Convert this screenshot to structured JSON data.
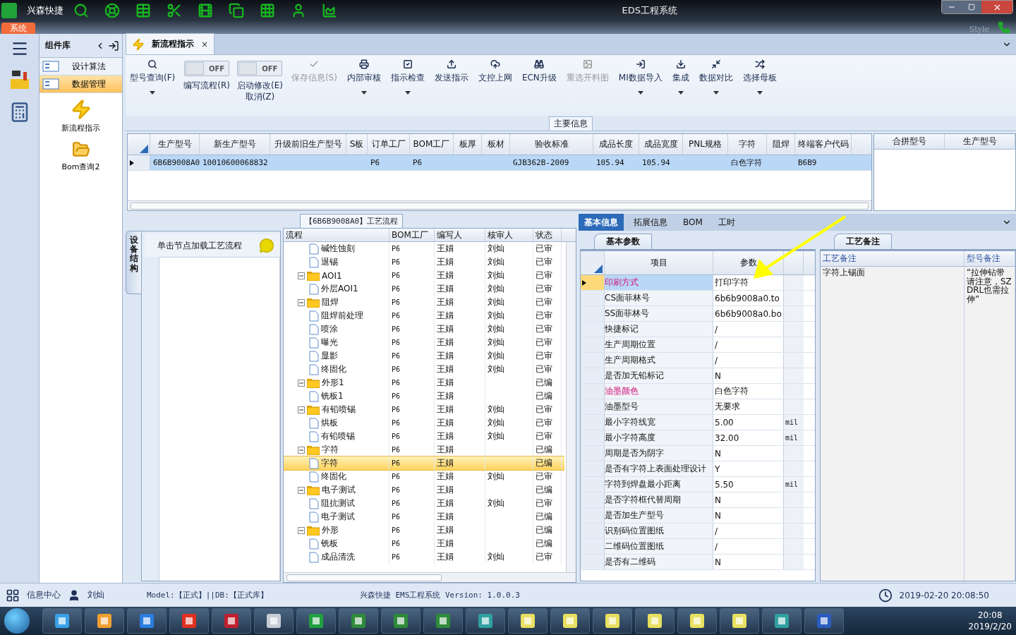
{
  "title_bar": {
    "app_name": "兴森快捷",
    "title": "EDS工程系统",
    "system_tab": "系统",
    "style_label": "Style"
  },
  "nav_panel": {
    "title": "组件库",
    "items": [
      {
        "label": "设计算法",
        "selected": false
      },
      {
        "label": "数据管理",
        "selected": true
      }
    ],
    "tiles": [
      {
        "label": "新流程指示",
        "kind": "flash"
      },
      {
        "label": "Bom查询2",
        "kind": "folder"
      }
    ]
  },
  "doc_tab": {
    "label": "新流程指示",
    "close": "×"
  },
  "ribbon": [
    {
      "kind": "button",
      "label": "型号查询(F)",
      "dropdown": true,
      "disabled": false
    },
    {
      "kind": "toggle",
      "label": "编写流程(R)",
      "state_text": "OFF",
      "on": false
    },
    {
      "kind": "toggle",
      "label": "启动修改(E)",
      "label2": "取消(Z)",
      "state_text": "OFF",
      "on": false
    },
    {
      "kind": "button",
      "label": "保存信息(S)",
      "dropdown": false,
      "disabled": true
    },
    {
      "kind": "button",
      "label": "内部审核",
      "dropdown": true,
      "disabled": false
    },
    {
      "kind": "button",
      "label": "指示检查",
      "dropdown": true,
      "disabled": false
    },
    {
      "kind": "button",
      "label": "发送指示",
      "dropdown": false,
      "disabled": false
    },
    {
      "kind": "button",
      "label": "文控上网",
      "dropdown": false,
      "disabled": false
    },
    {
      "kind": "button",
      "label": "ECN升级",
      "dropdown": false,
      "disabled": false
    },
    {
      "kind": "button",
      "label": "重选开料图",
      "dropdown": false,
      "disabled": true
    },
    {
      "kind": "button",
      "label": "MI数据导入",
      "dropdown": true,
      "disabled": false
    },
    {
      "kind": "button",
      "label": "集成",
      "dropdown": true,
      "disabled": false
    },
    {
      "kind": "button",
      "label": "数据对比",
      "dropdown": true,
      "disabled": false
    },
    {
      "kind": "button",
      "label": "选择母板",
      "dropdown": true,
      "disabled": false
    }
  ],
  "main_info": {
    "title": "主要信息",
    "columns": [
      "生产型号",
      "新生产型号",
      "升级前旧生产型号",
      "S板",
      "订单工厂",
      "BOM工厂",
      "板厚",
      "板材",
      "验收标准",
      "成品长度",
      "成品宽度",
      "PNL规格",
      "字符",
      "阻焊",
      "终端客户代码"
    ],
    "rows": [
      {
        "selected": true,
        "cells": [
          "6B6B9008A0",
          "10010600068832",
          null,
          null,
          "P6",
          "P6",
          null,
          null,
          "GJB362B-2009",
          "105.94",
          "105.94",
          null,
          "白色字符",
          null,
          "B6B9"
        ]
      }
    ],
    "side_columns": [
      "合拼型号",
      "生产型号"
    ]
  },
  "device_panel": {
    "vertical_tab": "设备结构",
    "hint": "单击节点加载工艺流程"
  },
  "process": {
    "title": "【6B6B9008A0】工艺流程",
    "columns": [
      "流程",
      "BOM工厂",
      "编写人",
      "核审人",
      "状态"
    ],
    "tree": [
      {
        "children": [
          {
            "label": "碱性蚀刻",
            "bom": "P6",
            "writer": "王娟",
            "reviewer": "刘灿",
            "status": "已审",
            "selected": false
          },
          {
            "label": "退锡",
            "bom": "P6",
            "writer": "王娟",
            "reviewer": "刘灿",
            "status": "已审",
            "selected": false
          }
        ]
      },
      {
        "label": "AOI1",
        "bom": "P6",
        "writer": "王娟",
        "reviewer": "刘灿",
        "status": "已审",
        "selected": false,
        "expanded": true,
        "children": [
          {
            "label": "外层AOI1",
            "bom": "P6",
            "writer": "王娟",
            "reviewer": "刘灿",
            "status": "已审",
            "selected": false
          }
        ]
      },
      {
        "label": "阻焊",
        "bom": "P6",
        "writer": "王娟",
        "reviewer": "刘灿",
        "status": "已审",
        "selected": false,
        "expanded": true,
        "children": [
          {
            "label": "阻焊前处理",
            "bom": "P6",
            "writer": "王娟",
            "reviewer": "刘灿",
            "status": "已审",
            "selected": false
          },
          {
            "label": "喷涂",
            "bom": "P6",
            "writer": "王娟",
            "reviewer": "刘灿",
            "status": "已审",
            "selected": false
          },
          {
            "label": "曝光",
            "bom": "P6",
            "writer": "王娟",
            "reviewer": "刘灿",
            "status": "已审",
            "selected": false
          },
          {
            "label": "显影",
            "bom": "P6",
            "writer": "王娟",
            "reviewer": "刘灿",
            "status": "已审",
            "selected": false
          },
          {
            "label": "终固化",
            "bom": "P6",
            "writer": "王娟",
            "reviewer": "刘灿",
            "status": "已审",
            "selected": false
          }
        ]
      },
      {
        "label": "外形1",
        "bom": "P6",
        "writer": "王娟",
        "status": "已编",
        "selected": false,
        "expanded": true,
        "children": [
          {
            "label": "铣板1",
            "bom": "P6",
            "writer": "王娟",
            "status": "已编",
            "selected": false
          }
        ]
      },
      {
        "label": "有铅喷锡",
        "bom": "P6",
        "writer": "王娟",
        "reviewer": "刘灿",
        "status": "已审",
        "selected": false,
        "expanded": true,
        "children": [
          {
            "label": "烘板",
            "bom": "P6",
            "writer": "王娟",
            "reviewer": "刘灿",
            "status": "已审",
            "selected": false
          },
          {
            "label": "有铅喷锡",
            "bom": "P6",
            "writer": "王娟",
            "reviewer": "刘灿",
            "status": "已审",
            "selected": false
          }
        ]
      },
      {
        "label": "字符",
        "bom": "P6",
        "writer": "王娟",
        "status": "已编",
        "selected": false,
        "expanded": true,
        "children": [
          {
            "label": "字符",
            "bom": "P6",
            "writer": "王娟",
            "status": "已编",
            "selected": true
          },
          {
            "label": "终固化",
            "bom": "P6",
            "writer": "王娟",
            "reviewer": "刘灿",
            "status": "已审",
            "selected": false
          }
        ]
      },
      {
        "label": "电子测试",
        "bom": "P6",
        "writer": "王娟",
        "status": "已编",
        "selected": false,
        "expanded": true,
        "children": [
          {
            "label": "阻抗测试",
            "bom": "P6",
            "writer": "王娟",
            "reviewer": "刘灿",
            "status": "已审",
            "selected": false
          },
          {
            "label": "电子测试",
            "bom": "P6",
            "writer": "王娟",
            "status": "已编",
            "selected": false
          }
        ]
      },
      {
        "label": "外形",
        "bom": "P6",
        "writer": "王娟",
        "status": "已编",
        "selected": false,
        "expanded": true,
        "children": [
          {
            "label": "铣板",
            "bom": "P6",
            "writer": "王娟",
            "status": "已编",
            "selected": false
          },
          {
            "label": "成品清洗",
            "bom": "P6",
            "writer": "王娟",
            "reviewer": "刘灿",
            "status": "已审",
            "selected": false
          }
        ]
      }
    ]
  },
  "detail_tabs": [
    {
      "label": "基本信息",
      "selected": true
    },
    {
      "label": "拓展信息",
      "selected": false
    },
    {
      "label": "BOM",
      "selected": false
    },
    {
      "label": "工时",
      "selected": false
    }
  ],
  "basic_params": {
    "tab": "基本参数",
    "columns": [
      "项目",
      "参数"
    ],
    "rows": [
      {
        "item": "印刷方式",
        "value": "打印字符",
        "emphasized": true,
        "selected": true
      },
      {
        "item": "CS面菲林号",
        "value": "6b6b9008a0.to",
        "emphasized": false,
        "selected": false
      },
      {
        "item": "SS面菲林号",
        "value": "6b6b9008a0.bo",
        "emphasized": false,
        "selected": false
      },
      {
        "item": "快捷标记",
        "value": "/",
        "emphasized": false,
        "selected": false
      },
      {
        "item": "生产周期位置",
        "value": "/",
        "emphasized": false,
        "selected": false
      },
      {
        "item": "生产周期格式",
        "value": "/",
        "emphasized": false,
        "selected": false
      },
      {
        "item": "是否加无铅标记",
        "value": "N",
        "emphasized": false,
        "selected": false
      },
      {
        "item": "油墨颜色",
        "value": "白色字符",
        "emphasized": true,
        "selected": false
      },
      {
        "item": "油墨型号",
        "value": "无要求",
        "emphasized": false,
        "selected": false
      },
      {
        "item": "最小字符线宽",
        "value": "5.00",
        "unit": "mil",
        "emphasized": false,
        "selected": false
      },
      {
        "item": "最小字符高度",
        "value": "32.00",
        "unit": "mil",
        "emphasized": false,
        "selected": false
      },
      {
        "item": "周期是否为阴字",
        "value": "N",
        "emphasized": false,
        "selected": false
      },
      {
        "item": "是否有字符上表面处理设计",
        "value": "Y",
        "emphasized": false,
        "selected": false
      },
      {
        "item": "字符到焊盘最小距离",
        "value": "5.50",
        "unit": "mil",
        "emphasized": false,
        "selected": false
      },
      {
        "item": "是否字符框代替周期",
        "value": "N",
        "emphasized": false,
        "selected": false
      },
      {
        "item": "是否加生产型号",
        "value": "N",
        "emphasized": false,
        "selected": false
      },
      {
        "item": "识别码位置图纸",
        "value": "/",
        "emphasized": false,
        "selected": false
      },
      {
        "item": "二维码位置图纸",
        "value": "/",
        "emphasized": false,
        "selected": false
      },
      {
        "item": "是否有二维码",
        "value": "N",
        "emphasized": false,
        "selected": false
      }
    ]
  },
  "process_notes": {
    "tab": "工艺备注",
    "columns": [
      "工艺备注",
      "型号备注"
    ],
    "process_note": "字符上锡面",
    "model_note": "“拉伸钻带请注意，SZDRL也需拉伸”"
  },
  "status_bar": {
    "info_center": "信息中心",
    "user": "刘灿",
    "model": "Model:【正式】||DB:【正式库】",
    "version": "兴森快捷 EMS工程系统 Version: 1.0.0.3",
    "datetime": "2019-02-20 20:08:50"
  },
  "taskbar": {
    "time": "20:08",
    "date": "2019/2/20"
  }
}
